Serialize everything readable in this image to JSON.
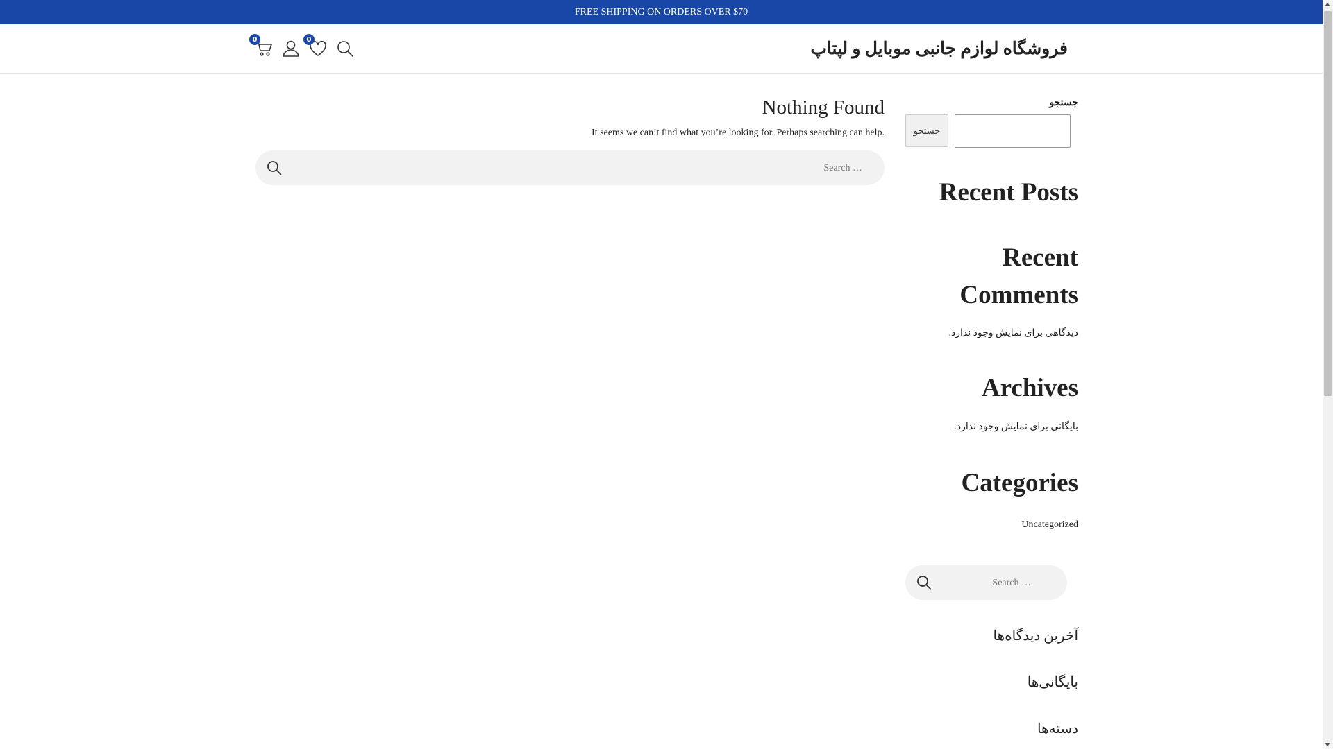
{
  "topbar": {
    "text": "FREE SHIPPING ON ORDERS OVER $70"
  },
  "header": {
    "site_title": "فروشگاه لوازم جانبی موبایل و لپتاپ",
    "cart_count": "0",
    "wishlist_count": "0",
    "icons": [
      "cart-icon",
      "account-icon",
      "wishlist-icon",
      "search-icon"
    ]
  },
  "main": {
    "title": "Nothing Found",
    "text": "It seems we can’t find what you’re looking for. Perhaps searching can help.",
    "search_placeholder": "Search …"
  },
  "sidebar": {
    "search_label": "جستجو",
    "search_button": "جستجو",
    "recent_posts_title": "Recent Posts",
    "recent_comments_title": "Recent Comments",
    "recent_comments_text": "دیدگاهی برای نمایش وجود ندارد.",
    "archives_title": "Archives",
    "archives_text": "بایگانی برای نمایش وجود ندارد.",
    "categories_title": "Categories",
    "category_item": "Uncategorized",
    "search_placeholder": "Search …",
    "latest_comments_heading": "آخرین دیدگاه‌ها",
    "archives_heading": "بایگانی‌ها",
    "categories_heading": "دسته‌ها"
  },
  "colors": {
    "brand": "#1847a8",
    "search_bg": "#f2f2f2"
  }
}
